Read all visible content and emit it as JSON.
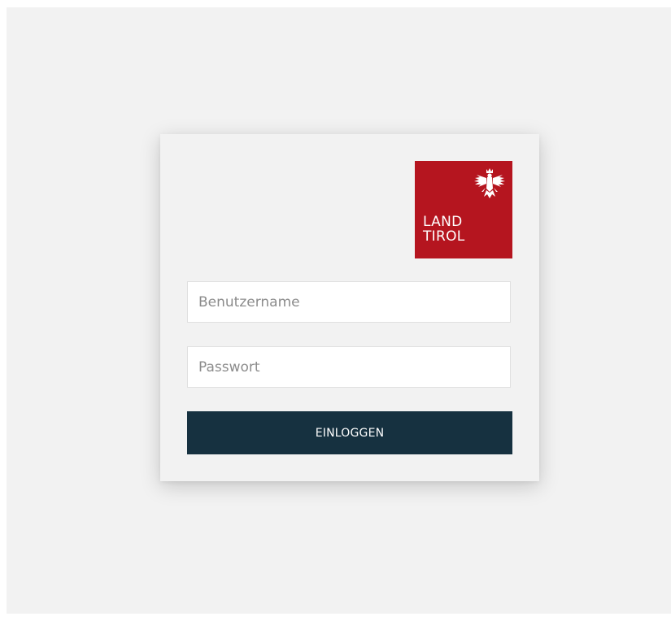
{
  "logo": {
    "line1": "LAND",
    "line2": "TIROL",
    "brand_color": "#b5151f",
    "icon": "tyrolean-eagle-icon"
  },
  "login_form": {
    "username_placeholder": "Benutzername",
    "username_value": "",
    "password_placeholder": "Passwort",
    "password_value": "",
    "submit_label": "EINLOGGEN",
    "button_color": "#163140"
  }
}
